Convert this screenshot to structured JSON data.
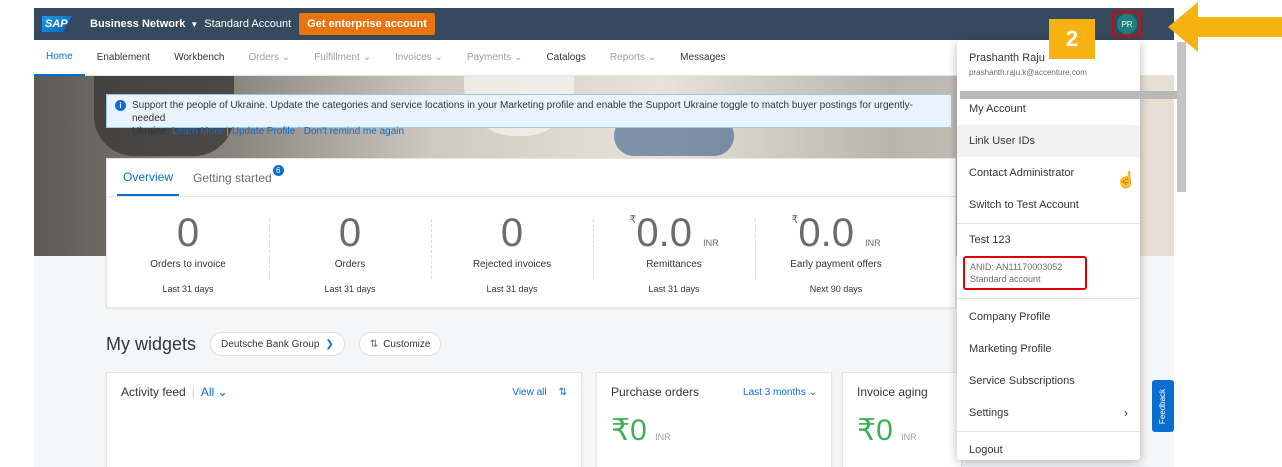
{
  "shell": {
    "logo": "SAP",
    "network": "Business Network",
    "account_type": "Standard Account",
    "enterprise_button": "Get enterprise account",
    "avatar_initials": "PR"
  },
  "nav": [
    "Home",
    "Enablement",
    "Workbench",
    "Orders",
    "Fulfillment",
    "Invoices",
    "Payments",
    "Catalogs",
    "Reports",
    "Messages"
  ],
  "banner": {
    "text": "Support the people of Ukraine. Update the categories and service locations in your Marketing profile and enable the Support Ukraine toggle to match buyer postings for urgently-needed",
    "text2": "Ukraine.",
    "learn_more": "Learn More",
    "update_profile": "Update Profile",
    "dont_remind": "Don't remind me again"
  },
  "overview": {
    "tabs": [
      "Overview",
      "Getting started"
    ],
    "badge": "6",
    "kpis": [
      {
        "value": "0",
        "label": "Orders to invoice",
        "period": "Last 31 days"
      },
      {
        "value": "0",
        "label": "Orders",
        "period": "Last 31 days"
      },
      {
        "value": "0",
        "label": "Rejected invoices",
        "period": "Last 31 days"
      },
      {
        "value": "0.0",
        "currency": "₹",
        "unit": "INR",
        "label": "Remittances",
        "period": "Last 31 days"
      },
      {
        "value": "0.0",
        "currency": "₹",
        "unit": "INR",
        "label": "Early payment offers",
        "period": "Next 90 days"
      }
    ]
  },
  "widgets": {
    "title": "My widgets",
    "group": "Deutsche Bank Group",
    "customize": "Customize",
    "activity": {
      "title": "Activity feed",
      "filter": "All",
      "view_all": "View all"
    },
    "purchase": {
      "title": "Purchase orders",
      "range": "Last 3 months",
      "amount": "₹0",
      "unit": "INR"
    },
    "aging": {
      "title": "Invoice aging",
      "amount": "₹0",
      "unit": "INR"
    }
  },
  "menu": {
    "name": "Prashanth Raju",
    "email": "prashanth.raju.k@accenture.com",
    "items_top": [
      "My Account",
      "Link User IDs",
      "Contact Administrator",
      "Switch to Test Account"
    ],
    "account_name": "Test 123",
    "anid": "ANID: AN11170003052",
    "account_kind": "Standard account",
    "items_bottom": [
      "Company Profile",
      "Marketing Profile",
      "Service Subscriptions",
      "Settings",
      "Logout"
    ]
  },
  "annotation": {
    "step": "2"
  },
  "feedback": "Feedback",
  "colors": {
    "shell": "#354a5f",
    "accent": "#0a6ed1",
    "enterprise": "#e9730c",
    "annotation": "#f5b210",
    "highlight": "#e00000"
  }
}
